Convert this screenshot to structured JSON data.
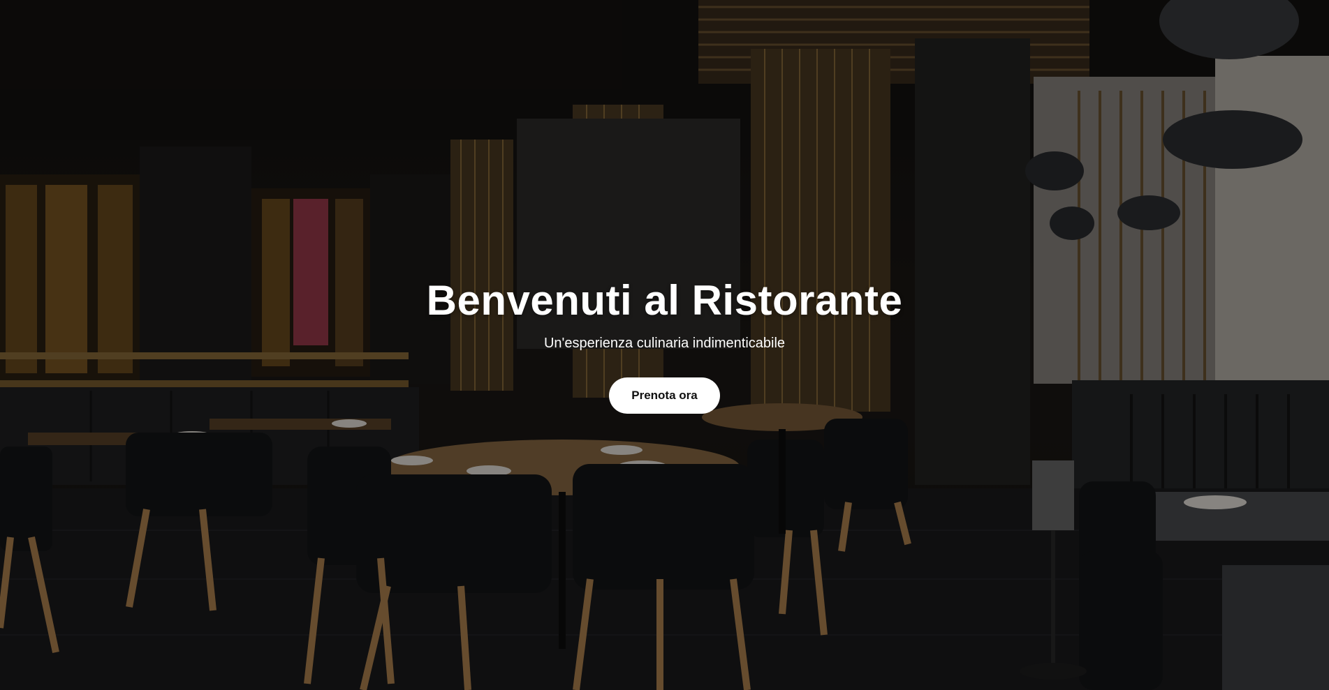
{
  "hero": {
    "title": "Benvenuti al Ristorante",
    "subtitle": "Un'esperienza culinaria indimenticabile",
    "cta_label": "Prenota ora",
    "background": "restaurant-interior-photo"
  },
  "colors": {
    "overlay": "#000000",
    "text": "#ffffff",
    "button_bg": "#ffffff",
    "button_text": "#111111"
  }
}
